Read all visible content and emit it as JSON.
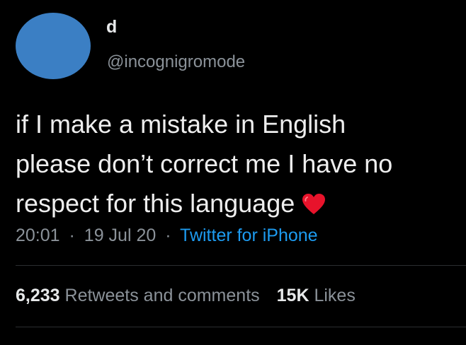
{
  "user": {
    "display_name": "d",
    "handle": "@incognigromode",
    "avatar_color": "#3b7fc4"
  },
  "tweet": {
    "lines": [
      "if I make a mistake in English",
      "please don’t correct me I have no",
      "respect for this language"
    ],
    "emoji": "red-heart-icon"
  },
  "meta": {
    "time": "20:01",
    "separator": "·",
    "date": "19 Jul 20",
    "source": "Twitter for iPhone",
    "source_color": "#1d9bf0"
  },
  "stats": {
    "retweets_count": "6,233",
    "retweets_label": "Retweets and comments",
    "likes_count": "15K",
    "likes_label": "Likes"
  }
}
